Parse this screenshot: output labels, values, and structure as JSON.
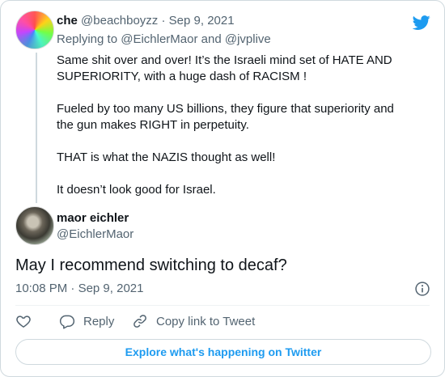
{
  "parent_tweet": {
    "display_name": "che",
    "handle": "@beachboyzz",
    "separator": "·",
    "date": "Sep 9, 2021",
    "replying_prefix": "Replying to",
    "replying_to_1": "@EichlerMaor",
    "replying_and": "and",
    "replying_to_2": "@jvplive",
    "paragraphs": [
      "Same shit over and over! It’s the Israeli mind set of HATE AND SUPERIORITY, with a huge dash of RACISM !",
      "Fueled by too many US billions, they figure that superiority and the gun makes RIGHT in perpetuity.",
      "THAT is what the NAZIS thought as well!",
      "It doesn’t look good for Israel."
    ]
  },
  "main_tweet": {
    "display_name": "maor eichler",
    "handle": "@EichlerMaor",
    "text": "May I recommend switching to decaf?",
    "time": "10:08 PM",
    "separator": "·",
    "date": "Sep 9, 2021"
  },
  "actions": {
    "reply_label": "Reply",
    "copy_link_label": "Copy link to Tweet"
  },
  "explore_label": "Explore what's happening on Twitter",
  "icons": {
    "brand": "twitter-bird-icon",
    "info": "info-icon",
    "like": "heart-icon",
    "reply": "speech-bubble-icon",
    "copy": "link-icon"
  },
  "colors": {
    "accent": "#1d9bf0",
    "muted": "#536471",
    "text": "#0f1419",
    "border": "#cfd9de"
  }
}
